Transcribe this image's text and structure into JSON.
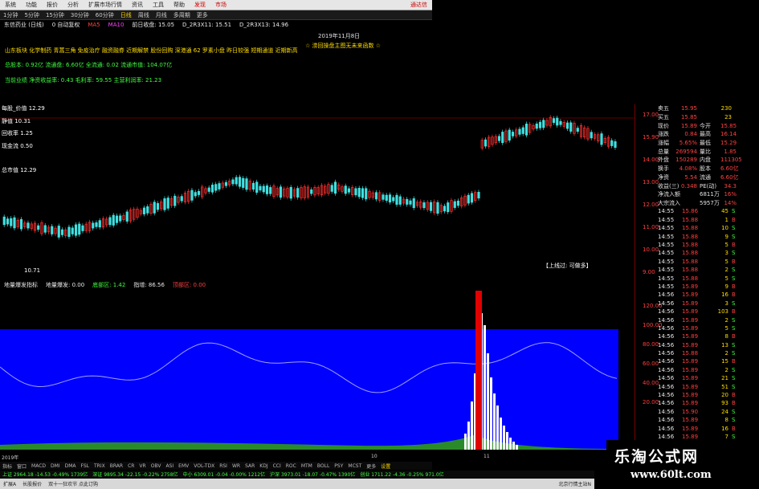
{
  "menu": {
    "items": [
      "系统",
      "功能",
      "报价",
      "分析",
      "扩展市场行情",
      "资讯",
      "工具",
      "帮助"
    ],
    "highlight1": "发现",
    "highlight2": "市场",
    "right": "通达信"
  },
  "toolbar": {
    "items": [
      "1分钟",
      "5分钟",
      "15分钟",
      "30分钟",
      "60分钟",
      "日线",
      "周线",
      "月线",
      "多周期",
      "更多"
    ],
    "active": "日线"
  },
  "info": {
    "stock": "东信药业 (日线)",
    "adjust": "0 自动复权",
    "ma1": "MA5",
    "ma2": "MA10",
    "close_label": "前日收盘: 15.05",
    "d1": "D_2R3X11: 15.51",
    "d2": "D_2R3X13: 14.96"
  },
  "date": "2019年11月8日",
  "banner": "☆ 涝回操盘主图无未来函数 ☆",
  "concepts": "山东板块 化学制药 青蒿三角 免疫治疗 融资融券 近期解禁 股份回购 深港通 62 罗素小盘 昨日较强 短期通道 近期新高",
  "capital": "总股本: 0.92亿  流通盘: 6.60亿  全流通: 0.02  流通市值: 104.07亿",
  "profit": "当前业绩   净资收益率: 0.43  毛利率: 59.55  主营利润率: 21.23",
  "main_labels": {
    "top": "每股_价值 12.29",
    "l1": "静值 10.31",
    "l2": "回收率 1.25",
    "l3": "现金流 0.50",
    "l4": "总市值 12.29",
    "low": "10.71",
    "tip": "【上线过: 可做多】"
  },
  "price_axis": [
    "17.00",
    "15.90",
    "14.00",
    "13.00",
    "12.00",
    "11.00",
    "10.00",
    "9.00"
  ],
  "indicator": {
    "name": "地量爆发指标",
    "v1": "地量爆发: 0.00",
    "v2": "底部区: 1.42",
    "v3": "指增: 86.56",
    "v4": "顶部区: 0.00"
  },
  "ind_axis": [
    "120.00",
    "100.00",
    "80.00",
    "60.00",
    "40.00",
    "20.00"
  ],
  "axis_years": [
    "2019年",
    "10",
    "11"
  ],
  "bottom_tabs": [
    "指标",
    "窗口",
    "MACD",
    "DMI",
    "DMA",
    "FSL",
    "TRIX",
    "BRAR",
    "CR",
    "VR",
    "OBV",
    "ASI",
    "EMV",
    "VOL-TDX",
    "RSI",
    "WR",
    "SAR",
    "KDJ",
    "CCI",
    "ROC",
    "MTM",
    "BOLL",
    "PSY",
    "MCST",
    "更多",
    "设置"
  ],
  "bottom_active": "设置",
  "status": [
    "上证 2964.18 -14.53 -0.49% 1739亿",
    "深证 9895.34 -22.15 -0.22% 2758亿",
    "中小 6309.01 -0.04 -0.00% 1212亿",
    "沪深 3973.01 -18.07 -0.47% 1390亿",
    "创业 1711.22 -4.36 -0.25% 971.0亿"
  ],
  "status2": [
    "扩展A",
    "长股报价",
    "双十一狂欢节 点此订购",
    "北京行情主站N"
  ],
  "quote": {
    "rows": [
      {
        "k": "卖五",
        "v": "15.95",
        "n": "230"
      },
      {
        "k": "买五",
        "v": "15.85",
        "n": "23"
      },
      {
        "k": "现价",
        "v": "15.89",
        "extra": "今开",
        "e": "15.85"
      },
      {
        "k": "涨跌",
        "v": "0.84",
        "extra": "最高",
        "e": "16.14"
      },
      {
        "k": "涨幅",
        "v": "5.65%",
        "extra": "最低",
        "e": "15.29"
      },
      {
        "k": "总量",
        "v": "269594",
        "extra": "量比",
        "e": "1.85"
      },
      {
        "k": "外盘",
        "v": "150289",
        "extra": "内盘",
        "e": "111305"
      },
      {
        "k": "换手",
        "v": "4.08%",
        "extra": "股本",
        "e": "6.60亿"
      },
      {
        "k": "净资",
        "v": "5.54",
        "extra": "流通",
        "e": "6.60亿"
      },
      {
        "k": "收益(三)",
        "v": "0.348",
        "extra": "PE(动)",
        "e": "34.3"
      },
      {
        "k": "净流入额",
        "v": "",
        "extra": "6811万",
        "e": "16%"
      },
      {
        "k": "大宗流入",
        "v": "",
        "extra": "5957万",
        "e": "14%"
      }
    ],
    "trades": [
      {
        "t": "14:55",
        "p": "15.86",
        "v": "45",
        "d": "S"
      },
      {
        "t": "14:55",
        "p": "15.88",
        "v": "1",
        "d": "B"
      },
      {
        "t": "14:55",
        "p": "15.88",
        "v": "10",
        "d": "S"
      },
      {
        "t": "14:55",
        "p": "15.88",
        "v": "9",
        "d": "S"
      },
      {
        "t": "14:55",
        "p": "15.88",
        "v": "5",
        "d": "B"
      },
      {
        "t": "14:55",
        "p": "15.88",
        "v": "3",
        "d": "S"
      },
      {
        "t": "14:55",
        "p": "15.88",
        "v": "5",
        "d": "B"
      },
      {
        "t": "14:55",
        "p": "15.88",
        "v": "2",
        "d": "S"
      },
      {
        "t": "14:55",
        "p": "15.88",
        "v": "5",
        "d": "S"
      },
      {
        "t": "14:55",
        "p": "15.89",
        "v": "9",
        "d": "B"
      },
      {
        "t": "14:56",
        "p": "15.89",
        "v": "16",
        "d": "B"
      },
      {
        "t": "14:56",
        "p": "15.89",
        "v": "3",
        "d": "S"
      },
      {
        "t": "14:56",
        "p": "15.89",
        "v": "103",
        "d": "B"
      },
      {
        "t": "14:56",
        "p": "15.89",
        "v": "2",
        "d": "S"
      },
      {
        "t": "14:56",
        "p": "15.89",
        "v": "5",
        "d": "S"
      },
      {
        "t": "14:56",
        "p": "15.89",
        "v": "8",
        "d": "B"
      },
      {
        "t": "14:56",
        "p": "15.89",
        "v": "13",
        "d": "S"
      },
      {
        "t": "14:56",
        "p": "15.88",
        "v": "2",
        "d": "S"
      },
      {
        "t": "14:56",
        "p": "15.89",
        "v": "15",
        "d": "B"
      },
      {
        "t": "14:56",
        "p": "15.89",
        "v": "2",
        "d": "S"
      },
      {
        "t": "14:56",
        "p": "15.89",
        "v": "21",
        "d": "S"
      },
      {
        "t": "14:56",
        "p": "15.89",
        "v": "51",
        "d": "S"
      },
      {
        "t": "14:56",
        "p": "15.89",
        "v": "20",
        "d": "B"
      },
      {
        "t": "14:56",
        "p": "15.89",
        "v": "93",
        "d": "B"
      },
      {
        "t": "14:56",
        "p": "15.90",
        "v": "24",
        "d": "S"
      },
      {
        "t": "14:56",
        "p": "15.89",
        "v": "8",
        "d": "S"
      },
      {
        "t": "14:56",
        "p": "15.89",
        "v": "16",
        "d": "B"
      },
      {
        "t": "14:56",
        "p": "15.89",
        "v": "7",
        "d": "S"
      },
      {
        "t": "14:56",
        "p": "15.90",
        "v": "3",
        "d": "B"
      },
      {
        "t": "14:56",
        "p": "15.90",
        "v": "13",
        "d": "S"
      },
      {
        "t": "14:56",
        "p": "15.90",
        "v": "5",
        "d": "B"
      },
      {
        "t": "14:56",
        "p": "15.90",
        "v": "52",
        "d": "S"
      }
    ]
  },
  "watermark": {
    "title": "乐淘公式网",
    "url": "www.60lt.com"
  },
  "colors": {
    "up": "#ff3030",
    "down": "#40e0e0",
    "blue": "#0000ff",
    "yellow": "#ffdd00",
    "green": "#40ff40"
  }
}
